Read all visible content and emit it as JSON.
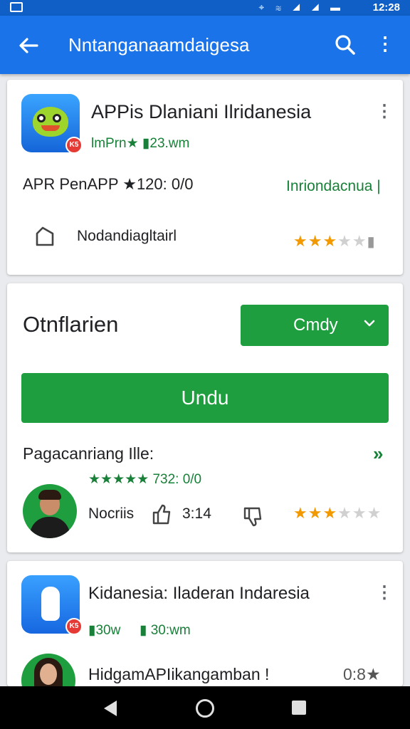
{
  "status_bar": {
    "time": "12:28",
    "icons": [
      "location-icon",
      "wifi-icon",
      "signal-icon",
      "battery-icon"
    ]
  },
  "app_bar": {
    "title": "Nntanganaamdaigesa",
    "back_icon": "arrow-left-icon",
    "search_icon": "search-icon",
    "more_icon": "more-vert-icon"
  },
  "card1": {
    "app_title": "APPis Dlaniani Ilridanesia",
    "sub": "lmPrn★ ▮23.wm",
    "row_left": "APR PenAPP ★120: 0/0",
    "row_right": "Inriondacnua |",
    "share_label": "Nodandiagltairl",
    "rating": 3
  },
  "card2": {
    "title": "Otnflarien",
    "dropdown_label": "Cmdy",
    "primary_button": "Undu",
    "subhead": "Pagacanriang Ille:",
    "rating_text": "★★★★★ 732: 0/0",
    "person_name": "Nocriis",
    "count": "3:14",
    "rating": 3
  },
  "card3": {
    "app_title": "Kidanesia: Iladeran Indaresia",
    "sub_left": "▮30w",
    "sub_right": "▮ 30:wm",
    "row_text": "HidgamAPIikangamban !",
    "row_right": "0:8★"
  },
  "colors": {
    "appbar": "#1a73e8",
    "green": "#1e9e3e",
    "star": "#f29900"
  }
}
